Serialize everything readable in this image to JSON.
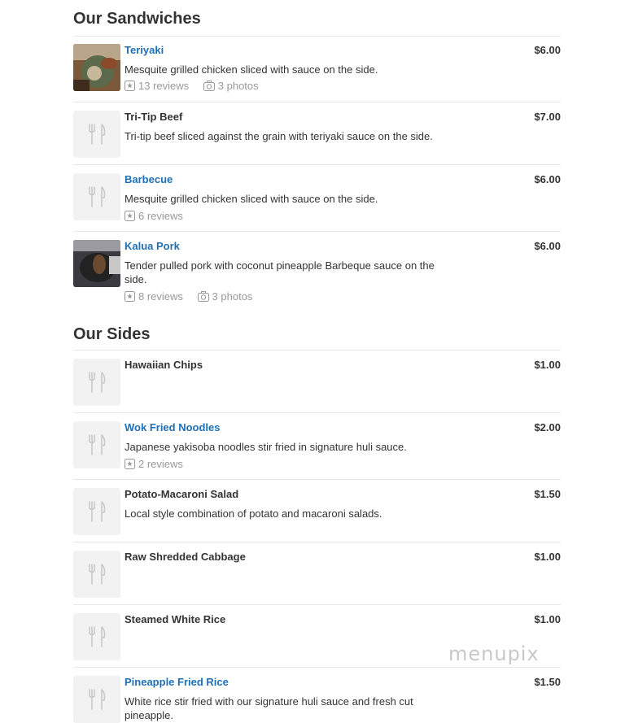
{
  "sections": [
    {
      "title": "Our Sandwiches",
      "items": [
        {
          "name": "Teriyaki",
          "price": "$6.00",
          "description": "Mesquite grilled chicken sliced with sauce on the side.",
          "reviews": "13 reviews",
          "photos": "3 photos",
          "linked": true,
          "thumbnail": "photo"
        },
        {
          "name": "Tri-Tip Beef",
          "price": "$7.00",
          "description": "Tri-tip beef sliced against the grain with teriyaki sauce on the side.",
          "linked": false,
          "thumbnail": "placeholder"
        },
        {
          "name": "Barbecue",
          "price": "$6.00",
          "description": "Mesquite grilled chicken sliced with sauce on the side.",
          "reviews": "6 reviews",
          "linked": true,
          "thumbnail": "placeholder"
        },
        {
          "name": "Kalua Pork",
          "price": "$6.00",
          "description": "Tender pulled pork with coconut pineapple Barbeque sauce on the side.",
          "reviews": "8 reviews",
          "photos": "3 photos",
          "linked": true,
          "thumbnail": "photo"
        }
      ]
    },
    {
      "title": "Our Sides",
      "items": [
        {
          "name": "Hawaiian Chips",
          "price": "$1.00",
          "linked": false,
          "thumbnail": "placeholder"
        },
        {
          "name": "Wok Fried Noodles",
          "price": "$2.00",
          "description": "Japanese yakisoba noodles stir fried in signature huli sauce.",
          "reviews": "2 reviews",
          "linked": true,
          "thumbnail": "placeholder"
        },
        {
          "name": "Potato-Macaroni Salad",
          "price": "$1.50",
          "description": "Local style combination of potato and macaroni salads.",
          "linked": false,
          "thumbnail": "placeholder"
        },
        {
          "name": "Raw Shredded Cabbage",
          "price": "$1.00",
          "linked": false,
          "thumbnail": "placeholder"
        },
        {
          "name": "Steamed White Rice",
          "price": "$1.00",
          "linked": false,
          "thumbnail": "placeholder"
        },
        {
          "name": "Pineapple Fried Rice",
          "price": "$1.50",
          "description": "White rice stir fried with our signature huli sauce and fresh cut pineapple.",
          "linked": true,
          "thumbnail": "placeholder"
        }
      ]
    }
  ],
  "watermark": "menupix",
  "icons": {
    "placeholder": "fork-knife-icon",
    "reviews": "review-star-icon",
    "photos": "camera-icon"
  },
  "colors": {
    "link": "#1f6fb5",
    "meta": "#999999",
    "placeholder_bg": "#f2f2f2"
  }
}
